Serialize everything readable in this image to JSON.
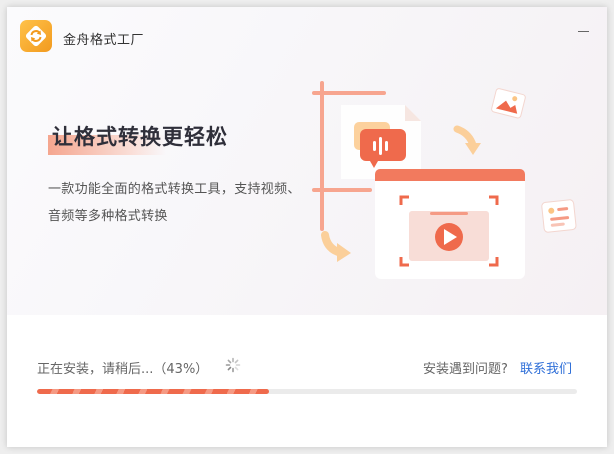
{
  "app": {
    "title": "金舟格式工厂",
    "logo_icon": "refresh-arrows-icon"
  },
  "window": {
    "minimize_icon": "minimize-icon"
  },
  "hero": {
    "slogan": "让格式转换更轻松",
    "description_line_1": "一款功能全面的格式转换工具，支持视频、",
    "description_line_2": "音频等多种格式转换",
    "illustration_icons": [
      "audio-card-icon",
      "video-player-icon",
      "image-icon",
      "document-icon",
      "arrow-icon"
    ]
  },
  "install": {
    "status_text": "正在安装，请稍后...（43%）",
    "progress": 0.43,
    "help_text": "安装遇到问题?",
    "contact_link": "联系我们",
    "spinner_icon": "loading-spinner-icon"
  },
  "colors": {
    "accent": "#ef6a4c",
    "accent_light": "#f59a84",
    "link": "#2f6fd8",
    "logo": "#f5a623"
  }
}
